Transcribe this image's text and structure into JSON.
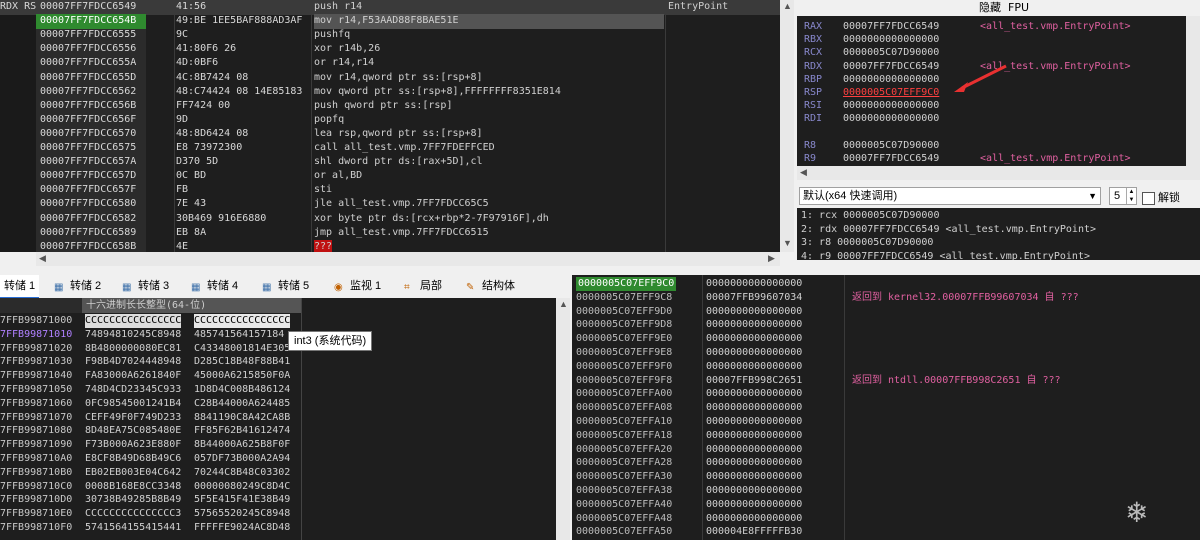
{
  "disasm": {
    "rows": [
      {
        "reg": "RDX RS",
        "addr": "00007FF7FDCC6549",
        "bytes": "41:56",
        "ins": "push r14",
        "cmt": "EntryPoint",
        "style": "sel"
      },
      {
        "reg": "",
        "addr": "00007FF7FDCC654B",
        "bytes": "49:BE 1EE5BAF888AD3AF",
        "ins": "mov r14,F53AAD88F8BAE51E",
        "cmt": "",
        "style": "cur"
      },
      {
        "reg": "",
        "addr": "00007FF7FDCC6555",
        "bytes": "9C",
        "ins": "pushfq",
        "cmt": "",
        "style": "blue"
      },
      {
        "reg": "",
        "addr": "00007FF7FDCC6556",
        "bytes": "41:80F6 26",
        "ins": "xor r14b,26",
        "cmt": "",
        "style": "blue"
      },
      {
        "reg": "",
        "addr": "00007FF7FDCC655A",
        "bytes": "4D:0BF6",
        "ins": "or r14,r14",
        "cmt": "",
        "style": "blue"
      },
      {
        "reg": "",
        "addr": "00007FF7FDCC655D",
        "bytes": "4C:8B7424 08",
        "ins": "mov r14,qword ptr ss:[rsp+8]",
        "cmt": "",
        "style": ""
      },
      {
        "reg": "",
        "addr": "00007FF7FDCC6562",
        "bytes": "48:C74424 08 14E85183",
        "ins": "mov qword ptr ss:[rsp+8],FFFFFFFF8351E814",
        "cmt": "",
        "style": ""
      },
      {
        "reg": "",
        "addr": "00007FF7FDCC656B",
        "bytes": "FF7424 00",
        "ins": "push qword ptr ss:[rsp]",
        "cmt": "",
        "style": ""
      },
      {
        "reg": "",
        "addr": "00007FF7FDCC656F",
        "bytes": "9D",
        "ins": "popfq",
        "cmt": "",
        "style": "blue"
      },
      {
        "reg": "",
        "addr": "00007FF7FDCC6570",
        "bytes": "48:8D6424 08",
        "ins": "lea rsp,qword ptr ss:[rsp+8]",
        "cmt": "",
        "style": ""
      },
      {
        "reg": "",
        "addr": "00007FF7FDCC6575",
        "bytes": "E8 73972300",
        "ins": "call all_test.vmp.7FF7FDEFFCED",
        "cmt": "",
        "style": "red"
      },
      {
        "reg": "",
        "addr": "00007FF7FDCC657A",
        "bytes": "D370 5D",
        "ins": "shl dword ptr ds:[rax+5D],cl",
        "cmt": "",
        "style": ""
      },
      {
        "reg": "",
        "addr": "00007FF7FDCC657D",
        "bytes": "0C BD",
        "ins": "or al,BD",
        "cmt": "",
        "style": "blue"
      },
      {
        "reg": "",
        "addr": "00007FF7FDCC657F",
        "bytes": "FB",
        "ins": "sti",
        "cmt": "",
        "style": "blue"
      },
      {
        "reg": "",
        "addr": "00007FF7FDCC6580",
        "bytes": "7E 43",
        "ins": "jle all_test.vmp.7FF7FDCC65C5",
        "cmt": "",
        "style": "red"
      },
      {
        "reg": "",
        "addr": "00007FF7FDCC6582",
        "bytes": "30B469 916E6880",
        "ins": "xor byte ptr ds:[rcx+rbp*2-7F97916F],dh",
        "cmt": "",
        "style": ""
      },
      {
        "reg": "",
        "addr": "00007FF7FDCC6589",
        "bytes": "EB 8A",
        "ins": "jmp all_test.vmp.7FF7FDCC6515",
        "cmt": "",
        "style": "red"
      },
      {
        "reg": "",
        "addr": "00007FF7FDCC658B",
        "bytes": "4E",
        "ins": "???",
        "cmt": "",
        "style": "q"
      }
    ]
  },
  "registers": {
    "header": {
      "hide": "隐藏",
      "fpu": "FPU"
    },
    "rows": [
      {
        "name": "RAX",
        "value": "00007FF7FDCC6549",
        "comment": "<all_test.vmp.EntryPoint>",
        "mod": false
      },
      {
        "name": "RBX",
        "value": "0000000000000000",
        "comment": "",
        "mod": false
      },
      {
        "name": "RCX",
        "value": "0000005C07D90000",
        "comment": "",
        "mod": false
      },
      {
        "name": "RDX",
        "value": "00007FF7FDCC6549",
        "comment": "<all_test.vmp.EntryPoint>",
        "mod": false
      },
      {
        "name": "RBP",
        "value": "0000000000000000",
        "comment": "",
        "mod": false
      },
      {
        "name": "RSP",
        "value": "0000005C07EFF9C0",
        "comment": "",
        "mod": true
      },
      {
        "name": "RSI",
        "value": "0000000000000000",
        "comment": "",
        "mod": false
      },
      {
        "name": "RDI",
        "value": "0000000000000000",
        "comment": "",
        "mod": false
      },
      {
        "name": "",
        "value": "",
        "comment": "",
        "mod": false
      },
      {
        "name": "R8",
        "value": "0000005C07D90000",
        "comment": "",
        "mod": false
      },
      {
        "name": "R9",
        "value": "00007FF7FDCC6549",
        "comment": "<all_test.vmp.EntryPoint>",
        "mod": false
      }
    ],
    "callconv": {
      "selected": "默认(x64 快速调用)",
      "count": "5",
      "unlock": "解锁"
    },
    "args": [
      "1: rcx 0000005C07D90000",
      "2: rdx 00007FF7FDCC6549 <all_test.vmp.EntryPoint>",
      "3: r8 0000005C07D90000",
      "4: r9 00007FF7FDCC6549 <all_test.vmp.EntryPoint>"
    ]
  },
  "tabs": [
    {
      "label": "转储 1",
      "active": true
    },
    {
      "label": "转储 2",
      "active": false
    },
    {
      "label": "转储 3",
      "active": false
    },
    {
      "label": "转储 4",
      "active": false
    },
    {
      "label": "转储 5",
      "active": false
    },
    {
      "label": "监视 1",
      "active": false
    },
    {
      "label": "局部",
      "active": false
    },
    {
      "label": "结构体",
      "active": false
    }
  ],
  "dump": {
    "header": "十六进制长长整型(64-位)",
    "tooltip": "int3 (系统代码)",
    "rows": [
      {
        "addr": "7FFB99871000",
        "v1": "CCCCCCCCCCCCCCCC",
        "v2": "CCCCCCCCCCCCCCCC"
      },
      {
        "addr": "7FFB99871010",
        "v1": "74894810245C8948",
        "v2": "485741564157184"
      },
      {
        "addr": "7FFB99871020",
        "v1": "8B4800000080EC81",
        "v2": "C43348001814E305"
      },
      {
        "addr": "7FFB99871030",
        "v1": "F98B4D7024448948",
        "v2": "D285C18B48F88B41"
      },
      {
        "addr": "7FFB99871040",
        "v1": "FA83000A6261840F",
        "v2": "45000A6215850F0A"
      },
      {
        "addr": "7FFB99871050",
        "v1": "748D4CD23345C933",
        "v2": "1D8D4C008B486124"
      },
      {
        "addr": "7FFB99871060",
        "v1": "0FC98545001241B4",
        "v2": "C28B44000A624485"
      },
      {
        "addr": "7FFB99871070",
        "v1": "CEFF49F0F749D233",
        "v2": "8841190C8A42CA8B"
      },
      {
        "addr": "7FFB99871080",
        "v1": "8D48EA75C085480E",
        "v2": "FF85F62B41612474"
      },
      {
        "addr": "7FFB99871090",
        "v1": "F73B000A623E880F",
        "v2": "8B44000A625B8F0F"
      },
      {
        "addr": "7FFB998710A0",
        "v1": "E8CF8B49D68B49C6",
        "v2": "057DF73B000A2A94"
      },
      {
        "addr": "7FFB998710B0",
        "v1": "EB02EB003E04C642",
        "v2": "70244C8B48C03302"
      },
      {
        "addr": "7FFB998710C0",
        "v1": "0008B168E8CC3348",
        "v2": "00000080249C8D4C"
      },
      {
        "addr": "7FFB998710D0",
        "v1": "30738B49285B8B49",
        "v2": "5F5E415F41E38B49"
      },
      {
        "addr": "7FFB998710E0",
        "v1": "CCCCCCCCCCCCCCC3",
        "v2": "57565520245C8948"
      },
      {
        "addr": "7FFB998710F0",
        "v1": "5741564155415441",
        "v2": "FFFFFE9024AC8D48"
      }
    ]
  },
  "stack": {
    "rows": [
      {
        "addr": "0000005C07EFF9C0",
        "value": "0000000000000000",
        "comment": ""
      },
      {
        "addr": "0000005C07EFF9C8",
        "value": "00007FFB99607034",
        "comment": "返回到 kernel32.00007FFB99607034 自 ???"
      },
      {
        "addr": "0000005C07EFF9D0",
        "value": "0000000000000000",
        "comment": ""
      },
      {
        "addr": "0000005C07EFF9D8",
        "value": "0000000000000000",
        "comment": ""
      },
      {
        "addr": "0000005C07EFF9E0",
        "value": "0000000000000000",
        "comment": ""
      },
      {
        "addr": "0000005C07EFF9E8",
        "value": "0000000000000000",
        "comment": ""
      },
      {
        "addr": "0000005C07EFF9F0",
        "value": "0000000000000000",
        "comment": ""
      },
      {
        "addr": "0000005C07EFF9F8",
        "value": "00007FFB998C2651",
        "comment": "返回到 ntdll.00007FFB998C2651 自 ???"
      },
      {
        "addr": "0000005C07EFFA00",
        "value": "0000000000000000",
        "comment": ""
      },
      {
        "addr": "0000005C07EFFA08",
        "value": "0000000000000000",
        "comment": ""
      },
      {
        "addr": "0000005C07EFFA10",
        "value": "0000000000000000",
        "comment": ""
      },
      {
        "addr": "0000005C07EFFA18",
        "value": "0000000000000000",
        "comment": ""
      },
      {
        "addr": "0000005C07EFFA20",
        "value": "0000000000000000",
        "comment": ""
      },
      {
        "addr": "0000005C07EFFA28",
        "value": "0000000000000000",
        "comment": ""
      },
      {
        "addr": "0000005C07EFFA30",
        "value": "0000000000000000",
        "comment": ""
      },
      {
        "addr": "0000005C07EFFA38",
        "value": "0000000000000000",
        "comment": ""
      },
      {
        "addr": "0000005C07EFFA40",
        "value": "0000000000000000",
        "comment": ""
      },
      {
        "addr": "0000005C07EFFA48",
        "value": "0000000000000000",
        "comment": ""
      },
      {
        "addr": "0000005C07EFFA50",
        "value": "000004E8FFFFFB30",
        "comment": ""
      }
    ]
  },
  "colors": {
    "accent": "#2a6fd6",
    "current": "#2f8a2f",
    "modified": "#ff4040",
    "comment": "#e060a0"
  }
}
